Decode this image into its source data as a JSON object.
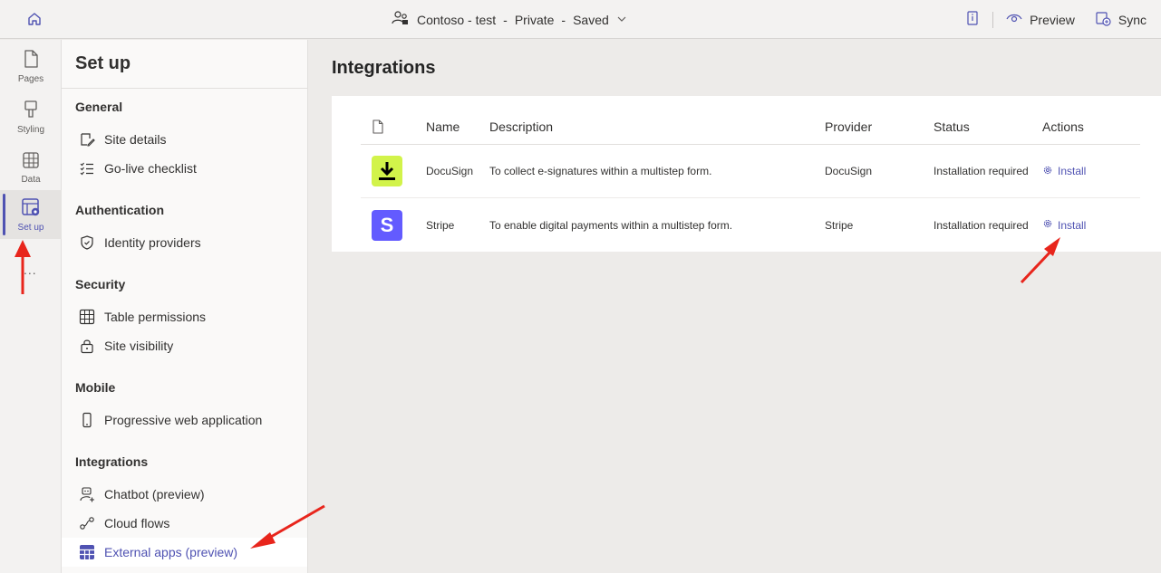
{
  "topbar": {
    "site_name": "Contoso - test",
    "visibility": "Private",
    "save_state": "Saved",
    "separator": "-",
    "preview_label": "Preview",
    "sync_label": "Sync"
  },
  "rail": {
    "items": [
      {
        "label": "Pages",
        "icon": "page-icon"
      },
      {
        "label": "Styling",
        "icon": "paintbrush-icon"
      },
      {
        "label": "Data",
        "icon": "table-icon"
      },
      {
        "label": "Set up",
        "icon": "setup-icon",
        "active": true
      }
    ],
    "more": "..."
  },
  "panel": {
    "title": "Set up",
    "sections": [
      {
        "heading": "General",
        "items": [
          {
            "label": "Site details",
            "icon": "edit-document-icon"
          },
          {
            "label": "Go-live checklist",
            "icon": "checklist-icon"
          }
        ]
      },
      {
        "heading": "Authentication",
        "items": [
          {
            "label": "Identity providers",
            "icon": "shield-icon"
          }
        ]
      },
      {
        "heading": "Security",
        "items": [
          {
            "label": "Table permissions",
            "icon": "table-icon"
          },
          {
            "label": "Site visibility",
            "icon": "lock-icon"
          }
        ]
      },
      {
        "heading": "Mobile",
        "items": [
          {
            "label": "Progressive web application",
            "icon": "phone-icon"
          }
        ]
      },
      {
        "heading": "Integrations",
        "items": [
          {
            "label": "Chatbot (preview)",
            "icon": "bot-icon"
          },
          {
            "label": "Cloud flows",
            "icon": "flow-icon"
          },
          {
            "label": "External apps (preview)",
            "icon": "apps-grid-icon",
            "active": true
          }
        ]
      }
    ]
  },
  "main": {
    "title": "Integrations",
    "columns": [
      "Name",
      "Description",
      "Provider",
      "Status",
      "Actions"
    ],
    "rows": [
      {
        "name": "DocuSign",
        "description": "To collect e-signatures within a multistep form.",
        "provider": "DocuSign",
        "status": "Installation required",
        "action": "Install",
        "logo": "docusign-logo"
      },
      {
        "name": "Stripe",
        "description": "To enable digital payments within a multistep form.",
        "provider": "Stripe",
        "status": "Installation required",
        "action": "Install",
        "logo": "stripe-logo",
        "logo_letter": "S"
      }
    ]
  },
  "colors": {
    "accent": "#4f52b2",
    "docusign": "#d2f34a",
    "stripe": "#635bff",
    "annotation": "#e8251c"
  }
}
